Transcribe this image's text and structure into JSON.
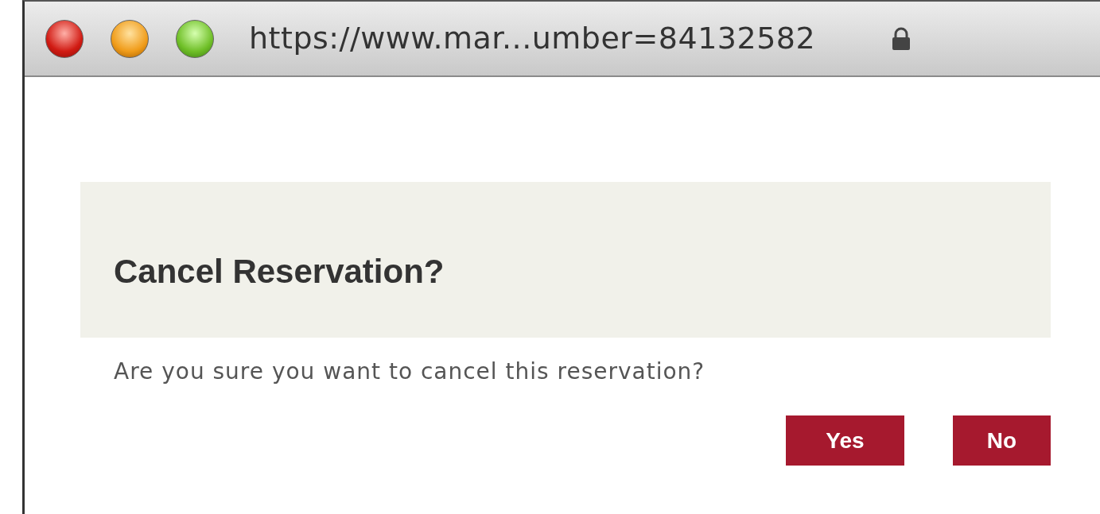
{
  "window": {
    "url": "https://www.mar...umber=84132582"
  },
  "dialog": {
    "title": "Cancel Reservation?",
    "message": "Are you sure you want to cancel this reservation?"
  },
  "buttons": [
    {
      "label": "Yes"
    },
    {
      "label": "No"
    }
  ]
}
